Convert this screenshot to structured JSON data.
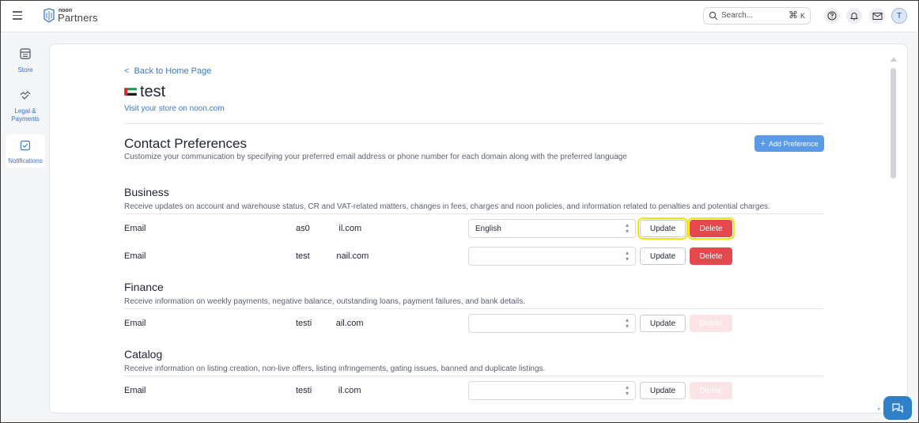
{
  "topbar": {
    "brand_small": "noon",
    "brand_big": "Partners",
    "search_placeholder": "Search...",
    "search_shortcut_symbol": "⌘",
    "search_shortcut_key": "K",
    "avatar_initial": "T"
  },
  "sidebar": {
    "items": [
      {
        "label": "Store",
        "icon": "store-icon"
      },
      {
        "label": "Legal & Payments",
        "icon": "handshake-icon"
      },
      {
        "label": "Notifications",
        "icon": "check-square-icon",
        "active": true
      }
    ]
  },
  "page": {
    "back_link": "Back to Home Page",
    "store_name": "test",
    "visit_link": "Visit your store on noon.com",
    "title": "Contact Preferences",
    "subtitle": "Customize your communication by specifying your preferred email address or phone number for each domain along with the preferred language",
    "add_button": "Add Preference"
  },
  "sections": [
    {
      "title": "Business",
      "description": "Receive updates on account and warehouse status, CR and VAT-related matters, changes in fees, charges and noon policies, and information related to penalties and potential charges.",
      "rows": [
        {
          "type": "Email",
          "email": "as0            il.com",
          "language": "English",
          "update": "Update",
          "delete": "Delete",
          "delete_enabled": true
        },
        {
          "type": "Email",
          "email": "test           nail.com",
          "language": "",
          "update": "Update",
          "delete": "Delete",
          "delete_enabled": true
        }
      ]
    },
    {
      "title": "Finance",
      "description": "Receive information on weekly payments, negative balance, outstanding loans, payment failures, and bank details.",
      "rows": [
        {
          "type": "Email",
          "email": "testi          ail.com",
          "language": "",
          "update": "Update",
          "delete": "Delete",
          "delete_enabled": false
        }
      ]
    },
    {
      "title": "Catalog",
      "description": "Receive information on listing creation, non-live offers, listing infringements, gating issues, banned and duplicate listings.",
      "rows": [
        {
          "type": "Email",
          "email": "testi           il.com",
          "language": "",
          "update": "Update",
          "delete": "Delete",
          "delete_enabled": false
        }
      ]
    }
  ],
  "colors": {
    "accent": "#3a78c9",
    "primary_button": "#5a9ae6",
    "delete": "#e5484d",
    "delete_disabled": "#fbe4e5",
    "highlight": "#f2e21a"
  }
}
